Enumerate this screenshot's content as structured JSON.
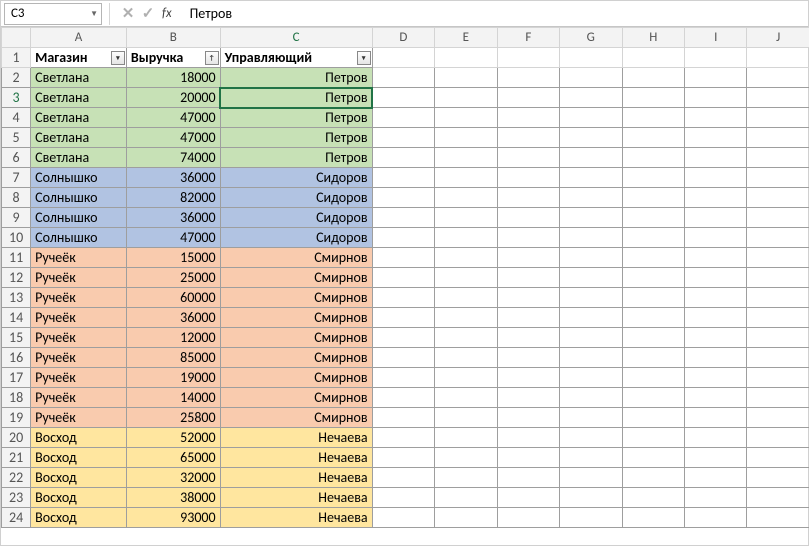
{
  "formula_bar": {
    "name_box": "C3",
    "fx_label": "fx",
    "input_value": "Петров"
  },
  "columns": [
    "A",
    "B",
    "C",
    "D",
    "E",
    "F",
    "G",
    "H",
    "I",
    "J"
  ],
  "headers": {
    "A": "Магазин",
    "B": "Выручка",
    "C": "Управляющий"
  },
  "rows": [
    {
      "n": 2,
      "store": "Светлана",
      "rev": 18000,
      "mgr": "Петров",
      "g": "green"
    },
    {
      "n": 3,
      "store": "Светлана",
      "rev": 20000,
      "mgr": "Петров",
      "g": "green"
    },
    {
      "n": 4,
      "store": "Светлана",
      "rev": 47000,
      "mgr": "Петров",
      "g": "green"
    },
    {
      "n": 5,
      "store": "Светлана",
      "rev": 47000,
      "mgr": "Петров",
      "g": "green"
    },
    {
      "n": 6,
      "store": "Светлана",
      "rev": 74000,
      "mgr": "Петров",
      "g": "green"
    },
    {
      "n": 7,
      "store": "Солнышко",
      "rev": 36000,
      "mgr": "Сидоров",
      "g": "blue"
    },
    {
      "n": 8,
      "store": "Солнышко",
      "rev": 82000,
      "mgr": "Сидоров",
      "g": "blue"
    },
    {
      "n": 9,
      "store": "Солнышко",
      "rev": 36000,
      "mgr": "Сидоров",
      "g": "blue"
    },
    {
      "n": 10,
      "store": "Солнышко",
      "rev": 47000,
      "mgr": "Сидоров",
      "g": "blue"
    },
    {
      "n": 11,
      "store": "Ручеёк",
      "rev": 15000,
      "mgr": "Смирнов",
      "g": "orange"
    },
    {
      "n": 12,
      "store": "Ручеёк",
      "rev": 25000,
      "mgr": "Смирнов",
      "g": "orange"
    },
    {
      "n": 13,
      "store": "Ручеёк",
      "rev": 60000,
      "mgr": "Смирнов",
      "g": "orange"
    },
    {
      "n": 14,
      "store": "Ручеёк",
      "rev": 36000,
      "mgr": "Смирнов",
      "g": "orange"
    },
    {
      "n": 15,
      "store": "Ручеёк",
      "rev": 12000,
      "mgr": "Смирнов",
      "g": "orange"
    },
    {
      "n": 16,
      "store": "Ручеёк",
      "rev": 85000,
      "mgr": "Смирнов",
      "g": "orange"
    },
    {
      "n": 17,
      "store": "Ручеёк",
      "rev": 19000,
      "mgr": "Смирнов",
      "g": "orange"
    },
    {
      "n": 18,
      "store": "Ручеёк",
      "rev": 14000,
      "mgr": "Смирнов",
      "g": "orange"
    },
    {
      "n": 19,
      "store": "Ручеёк",
      "rev": 25800,
      "mgr": "Смирнов",
      "g": "orange"
    },
    {
      "n": 20,
      "store": "Восход",
      "rev": 52000,
      "mgr": "Нечаева",
      "g": "yellow"
    },
    {
      "n": 21,
      "store": "Восход",
      "rev": 65000,
      "mgr": "Нечаева",
      "g": "yellow"
    },
    {
      "n": 22,
      "store": "Восход",
      "rev": 32000,
      "mgr": "Нечаева",
      "g": "yellow"
    },
    {
      "n": 23,
      "store": "Восход",
      "rev": 38000,
      "mgr": "Нечаева",
      "g": "yellow"
    },
    {
      "n": 24,
      "store": "Восход",
      "rev": 93000,
      "mgr": "Нечаева",
      "g": "yellow"
    }
  ],
  "active_cell": {
    "row": 3,
    "col": "C"
  }
}
